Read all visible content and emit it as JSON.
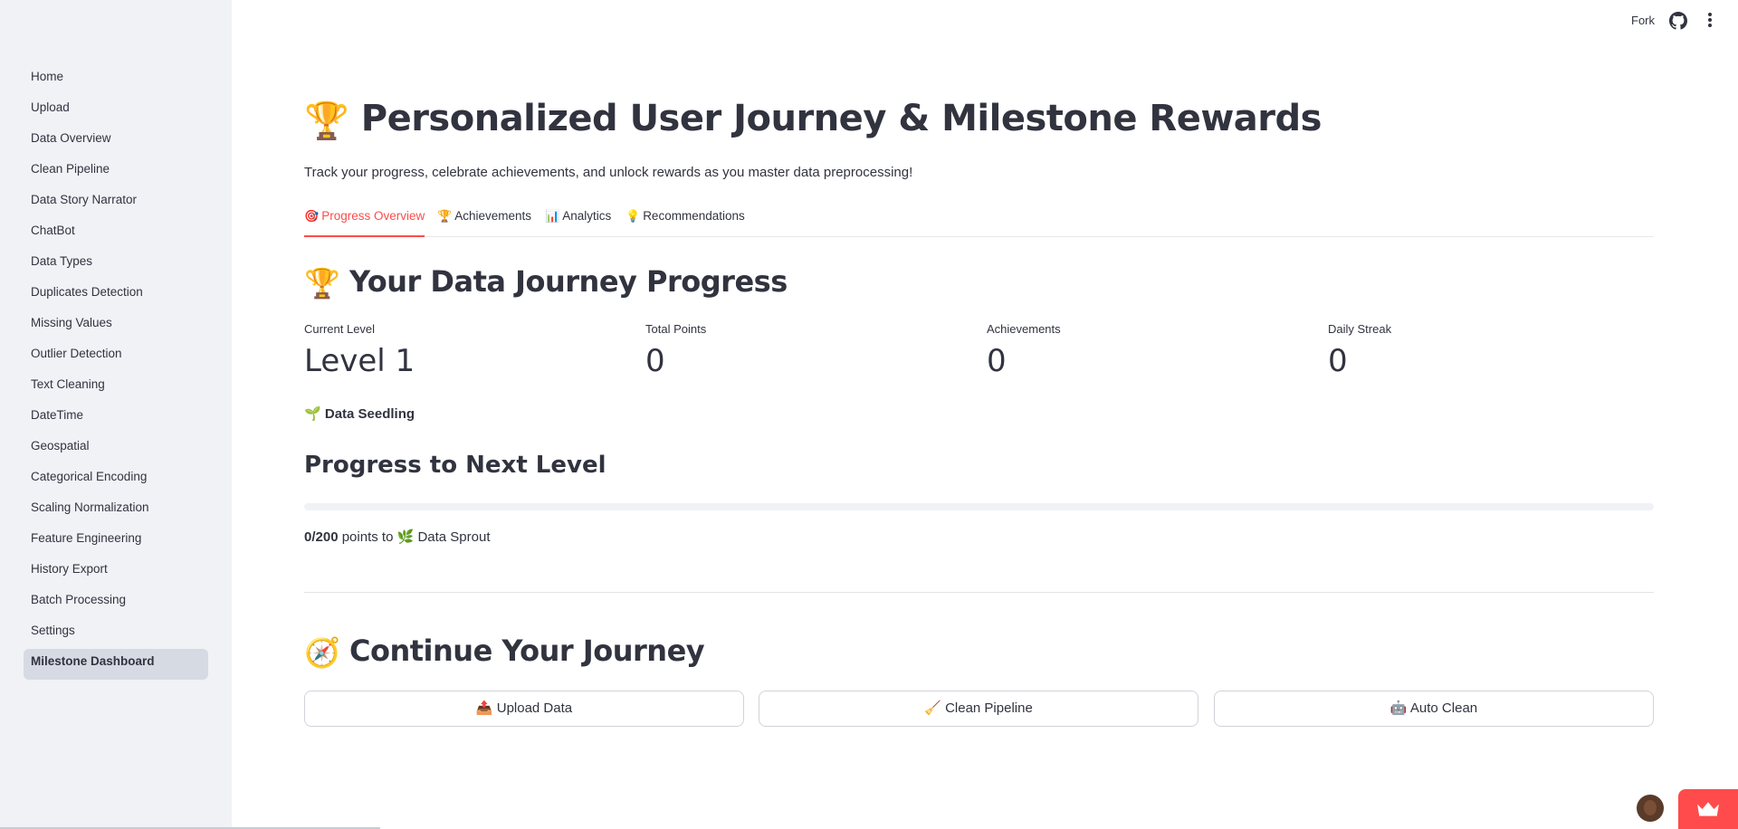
{
  "header": {
    "fork_label": "Fork"
  },
  "sidebar": {
    "items": [
      {
        "label": "Home"
      },
      {
        "label": "Upload"
      },
      {
        "label": "Data Overview"
      },
      {
        "label": "Clean Pipeline"
      },
      {
        "label": "Data Story Narrator"
      },
      {
        "label": "ChatBot"
      },
      {
        "label": "Data Types"
      },
      {
        "label": "Duplicates Detection"
      },
      {
        "label": "Missing Values"
      },
      {
        "label": "Outlier Detection"
      },
      {
        "label": "Text Cleaning"
      },
      {
        "label": "DateTime"
      },
      {
        "label": "Geospatial"
      },
      {
        "label": "Categorical Encoding"
      },
      {
        "label": "Scaling Normalization"
      },
      {
        "label": "Feature Engineering"
      },
      {
        "label": "History Export"
      },
      {
        "label": "Batch Processing"
      },
      {
        "label": "Settings"
      },
      {
        "label": "Milestone Dashboard",
        "active": true
      }
    ]
  },
  "main": {
    "title_emoji": "🏆",
    "title": "Personalized User Journey & Milestone Rewards",
    "subtitle": "Track your progress, celebrate achievements, and unlock rewards as you master data preprocessing!",
    "tabs": [
      {
        "icon": "🎯",
        "label": "Progress Overview",
        "active": true
      },
      {
        "icon": "🏆",
        "label": "Achievements"
      },
      {
        "icon": "📊",
        "label": "Analytics"
      },
      {
        "icon": "💡",
        "label": "Recommendations"
      }
    ],
    "section_emoji": "🏆",
    "section_title": "Your Data Journey Progress",
    "metrics": [
      {
        "label": "Current Level",
        "value": "Level 1"
      },
      {
        "label": "Total Points",
        "value": "0"
      },
      {
        "label": "Achievements",
        "value": "0"
      },
      {
        "label": "Daily Streak",
        "value": "0"
      }
    ],
    "level_badge": {
      "emoji": "🌱",
      "label": "Data Seedling"
    },
    "progress_heading": "Progress to Next Level",
    "progress": {
      "fraction": 0,
      "points_text": "0/200",
      "middle_text": " points to ",
      "next_emoji": "🌿",
      "next_level": "Data Sprout"
    },
    "continue_emoji": "🧭",
    "continue_title": "Continue Your Journey",
    "buttons": [
      {
        "icon": "📤",
        "label": "Upload Data"
      },
      {
        "icon": "🧹",
        "label": "Clean Pipeline"
      },
      {
        "icon": "🤖",
        "label": "Auto Clean"
      }
    ]
  },
  "colors": {
    "accent": "#ff4b4b",
    "sidebar_bg": "#f0f2f6",
    "text": "#31333f"
  }
}
